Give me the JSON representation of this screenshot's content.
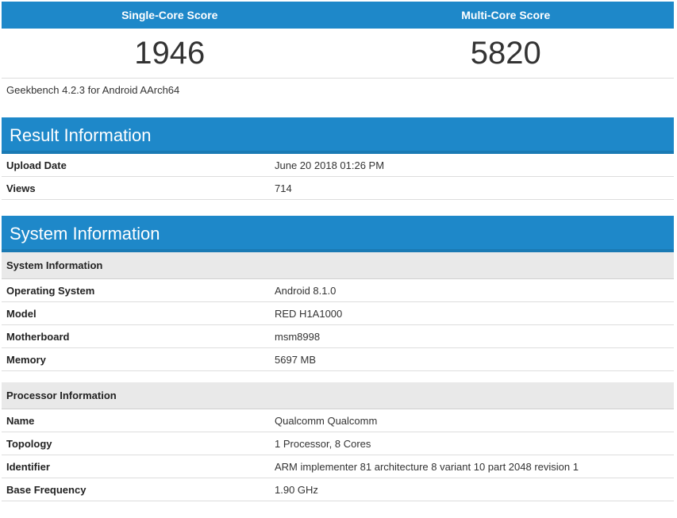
{
  "scores": {
    "single_label": "Single-Core Score",
    "multi_label": "Multi-Core Score",
    "single_value": "1946",
    "multi_value": "5820"
  },
  "version": "Geekbench 4.2.3 for Android AArch64",
  "result_information": {
    "title": "Result Information",
    "rows": [
      {
        "label": "Upload Date",
        "value": "June 20 2018 01:26 PM"
      },
      {
        "label": "Views",
        "value": "714"
      }
    ]
  },
  "system_information": {
    "title": "System Information",
    "system_subhead": "System Information",
    "system_rows": [
      {
        "label": "Operating System",
        "value": "Android 8.1.0"
      },
      {
        "label": "Model",
        "value": "RED H1A1000"
      },
      {
        "label": "Motherboard",
        "value": "msm8998"
      },
      {
        "label": "Memory",
        "value": "5697 MB"
      }
    ],
    "processor_subhead": "Processor Information",
    "processor_rows": [
      {
        "label": "Name",
        "value": "Qualcomm Qualcomm"
      },
      {
        "label": "Topology",
        "value": "1 Processor, 8 Cores"
      },
      {
        "label": "Identifier",
        "value": "ARM implementer 81 architecture 8 variant 10 part 2048 revision 1"
      },
      {
        "label": "Base Frequency",
        "value": "1.90 GHz"
      }
    ]
  },
  "colors": {
    "banner": "#1e88c9",
    "subhead_bg": "#e9e9e9"
  }
}
